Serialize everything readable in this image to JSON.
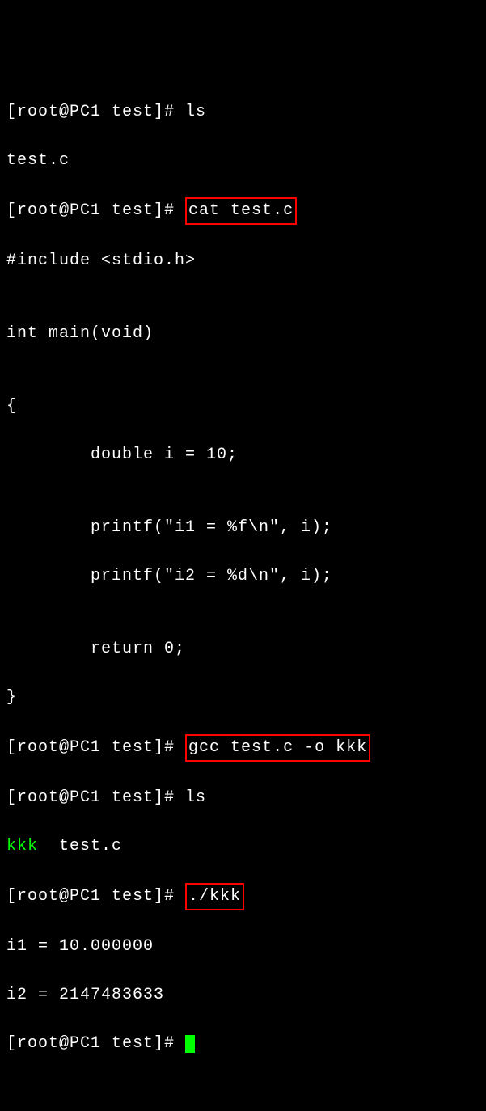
{
  "prompt": "[root@PC1 test]# ",
  "commands": {
    "ls": "ls",
    "cat": "cat test.c",
    "gcc": "gcc test.c -o kkk",
    "run": "./kkk"
  },
  "ls_output1": "test.c",
  "source": {
    "l1": "#include <stdio.h>",
    "l2": "",
    "l3": "int main(void)",
    "l4": "",
    "l5": "{",
    "l6": "        double i = 10;",
    "l7": "",
    "l8": "        printf(\"i1 = %f\\n\", i);",
    "l9": "        printf(\"i2 = %d\\n\", i);",
    "l10": "",
    "l11": "        return 0;",
    "l12": "}"
  },
  "ls_output2": {
    "kkk": "kkk",
    "rest": "  test.c"
  },
  "run_output": {
    "l1": "i1 = 10.000000",
    "l2": "i2 = 2147483633"
  }
}
